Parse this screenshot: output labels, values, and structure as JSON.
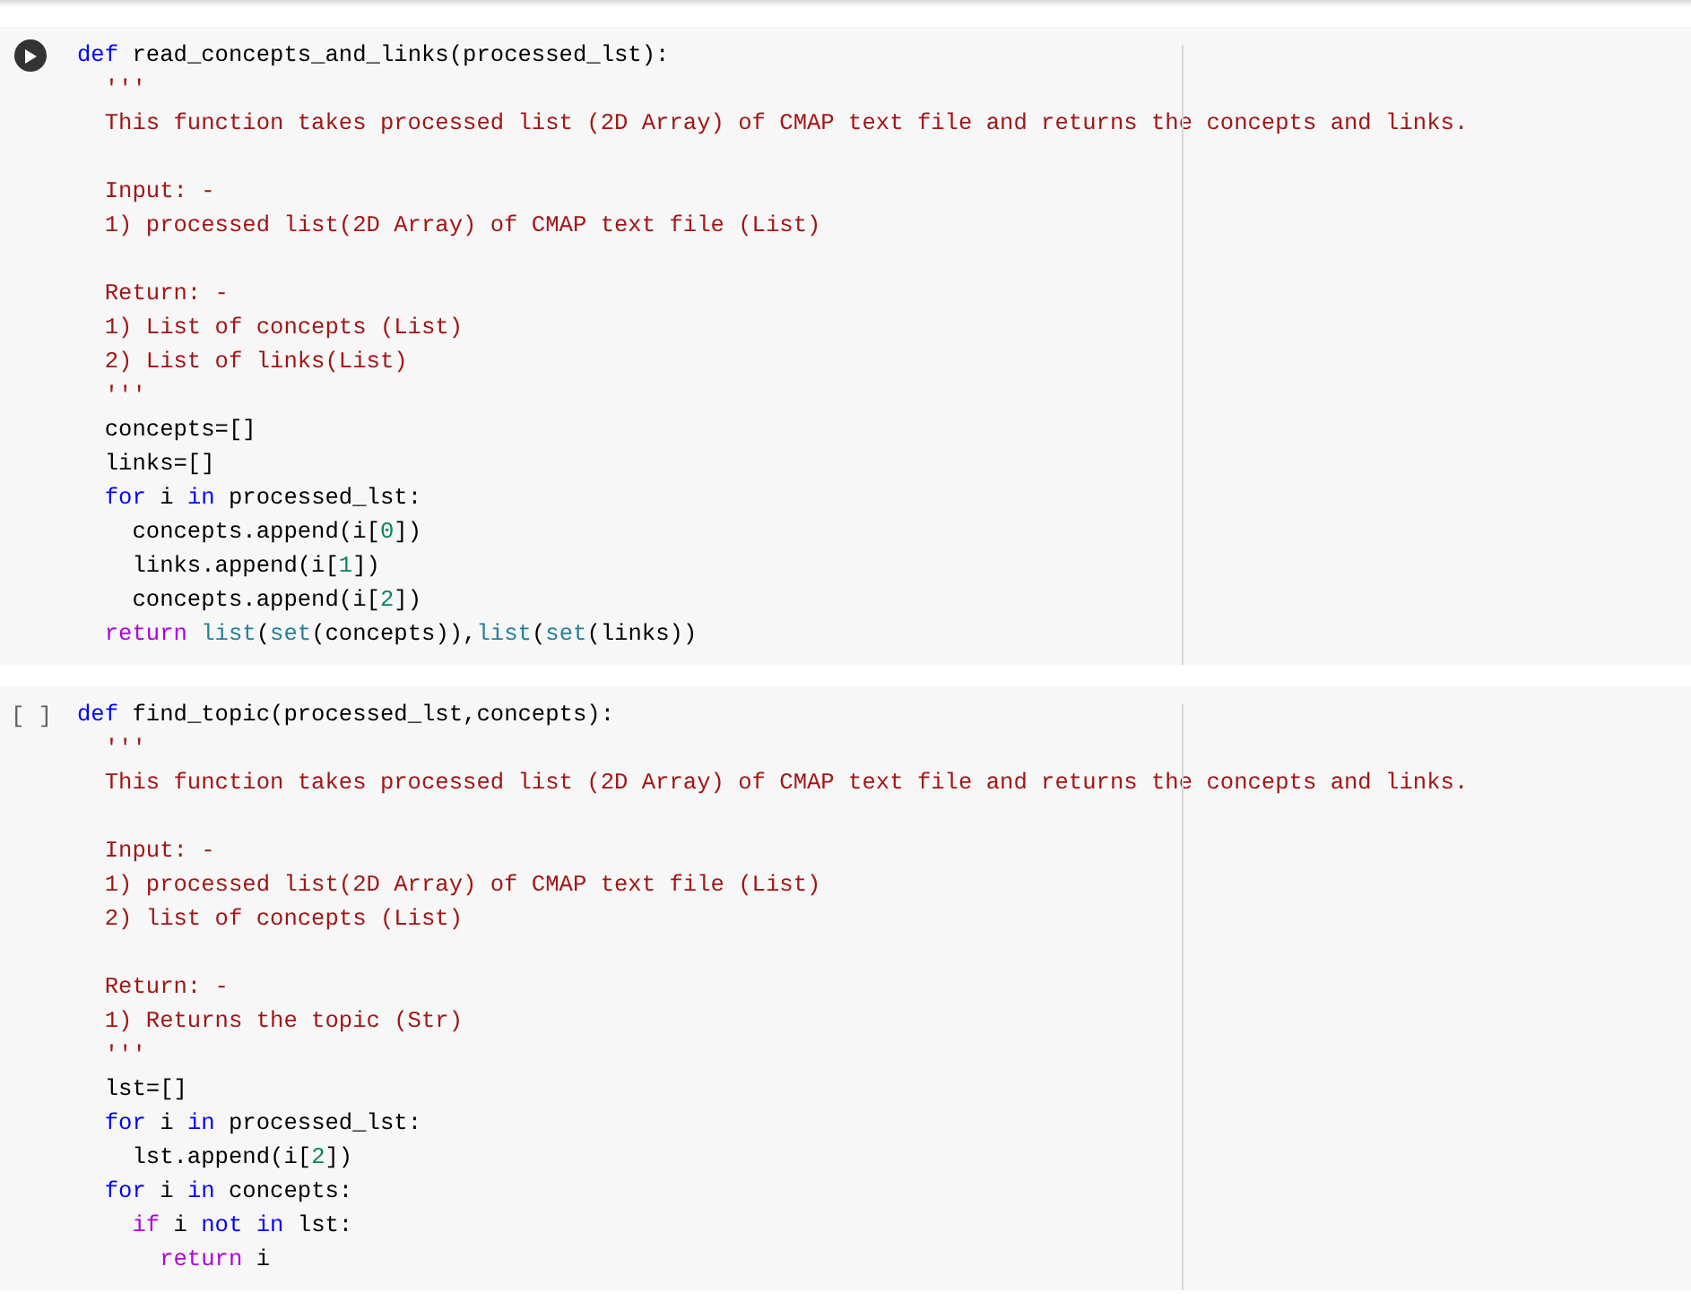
{
  "cells": [
    {
      "gutter": {
        "kind": "run_button"
      },
      "lines": [
        {
          "kind": "code",
          "tokens": [
            {
              "kind": "kw",
              "text": "def"
            },
            {
              "kind": "p",
              "text": " read_concepts_and_links(processed_lst):"
            }
          ]
        },
        {
          "kind": "code",
          "tokens": [
            {
              "kind": "str",
              "text": "  '''"
            }
          ]
        },
        {
          "kind": "code",
          "tokens": [
            {
              "kind": "str",
              "text": "  This function takes processed list (2D Array) of CMAP text file and returns the concepts and links."
            }
          ]
        },
        {
          "kind": "blank"
        },
        {
          "kind": "code",
          "tokens": [
            {
              "kind": "str",
              "text": "  Input: -"
            }
          ]
        },
        {
          "kind": "code",
          "tokens": [
            {
              "kind": "str",
              "text": "  1) processed list(2D Array) of CMAP text file (List)"
            }
          ]
        },
        {
          "kind": "blank"
        },
        {
          "kind": "code",
          "tokens": [
            {
              "kind": "str",
              "text": "  Return: -"
            }
          ]
        },
        {
          "kind": "code",
          "tokens": [
            {
              "kind": "str",
              "text": "  1) List of concepts (List)"
            }
          ]
        },
        {
          "kind": "code",
          "tokens": [
            {
              "kind": "str",
              "text": "  2) List of links(List)"
            }
          ]
        },
        {
          "kind": "code",
          "tokens": [
            {
              "kind": "str",
              "text": "  '''"
            }
          ]
        },
        {
          "kind": "code",
          "tokens": [
            {
              "kind": "p",
              "text": "  concepts=[]"
            }
          ]
        },
        {
          "kind": "code",
          "tokens": [
            {
              "kind": "p",
              "text": "  links=[]"
            }
          ]
        },
        {
          "kind": "code",
          "tokens": [
            {
              "kind": "kw",
              "text": "  for"
            },
            {
              "kind": "p",
              "text": " i "
            },
            {
              "kind": "kw",
              "text": "in"
            },
            {
              "kind": "p",
              "text": " processed_lst:"
            }
          ]
        },
        {
          "kind": "code",
          "tokens": [
            {
              "kind": "p",
              "text": "    concepts.append(i["
            },
            {
              "kind": "num",
              "text": "0"
            },
            {
              "kind": "p",
              "text": "])"
            }
          ]
        },
        {
          "kind": "code",
          "tokens": [
            {
              "kind": "p",
              "text": "    links.append(i["
            },
            {
              "kind": "num",
              "text": "1"
            },
            {
              "kind": "p",
              "text": "])"
            }
          ]
        },
        {
          "kind": "code",
          "tokens": [
            {
              "kind": "p",
              "text": "    concepts.append(i["
            },
            {
              "kind": "num",
              "text": "2"
            },
            {
              "kind": "p",
              "text": "])"
            }
          ]
        },
        {
          "kind": "code",
          "tokens": [
            {
              "kind": "ctrl",
              "text": "  return"
            },
            {
              "kind": "bi",
              "text": " list"
            },
            {
              "kind": "p",
              "text": "("
            },
            {
              "kind": "bi",
              "text": "set"
            },
            {
              "kind": "p",
              "text": "(concepts)),"
            },
            {
              "kind": "bi",
              "text": "list"
            },
            {
              "kind": "p",
              "text": "("
            },
            {
              "kind": "bi",
              "text": "set"
            },
            {
              "kind": "p",
              "text": "(links))"
            }
          ]
        }
      ]
    },
    {
      "gutter": {
        "kind": "execution_count",
        "text": "[ ]"
      },
      "lines": [
        {
          "kind": "code",
          "tokens": [
            {
              "kind": "kw",
              "text": "def"
            },
            {
              "kind": "p",
              "text": " find_topic(processed_lst,concepts):"
            }
          ]
        },
        {
          "kind": "code",
          "tokens": [
            {
              "kind": "str",
              "text": "  '''"
            }
          ]
        },
        {
          "kind": "code",
          "tokens": [
            {
              "kind": "str",
              "text": "  This function takes processed list (2D Array) of CMAP text file and returns the concepts and links."
            }
          ]
        },
        {
          "kind": "blank"
        },
        {
          "kind": "code",
          "tokens": [
            {
              "kind": "str",
              "text": "  Input: -"
            }
          ]
        },
        {
          "kind": "code",
          "tokens": [
            {
              "kind": "str",
              "text": "  1) processed list(2D Array) of CMAP text file (List)"
            }
          ]
        },
        {
          "kind": "code",
          "tokens": [
            {
              "kind": "str",
              "text": "  2) list of concepts (List)"
            }
          ]
        },
        {
          "kind": "blank"
        },
        {
          "kind": "code",
          "tokens": [
            {
              "kind": "str",
              "text": "  Return: -"
            }
          ]
        },
        {
          "kind": "code",
          "tokens": [
            {
              "kind": "str",
              "text": "  1) Returns the topic (Str)"
            }
          ]
        },
        {
          "kind": "code",
          "tokens": [
            {
              "kind": "str",
              "text": "  '''"
            }
          ]
        },
        {
          "kind": "code",
          "tokens": [
            {
              "kind": "p",
              "text": "  lst=[]"
            }
          ]
        },
        {
          "kind": "code",
          "tokens": [
            {
              "kind": "kw",
              "text": "  for"
            },
            {
              "kind": "p",
              "text": " i "
            },
            {
              "kind": "kw",
              "text": "in"
            },
            {
              "kind": "p",
              "text": " processed_lst:"
            }
          ]
        },
        {
          "kind": "code",
          "tokens": [
            {
              "kind": "p",
              "text": "    lst.append(i["
            },
            {
              "kind": "num",
              "text": "2"
            },
            {
              "kind": "p",
              "text": "])"
            }
          ]
        },
        {
          "kind": "code",
          "tokens": [
            {
              "kind": "kw",
              "text": "  for"
            },
            {
              "kind": "p",
              "text": " i "
            },
            {
              "kind": "kw",
              "text": "in"
            },
            {
              "kind": "p",
              "text": " concepts:"
            }
          ]
        },
        {
          "kind": "code",
          "tokens": [
            {
              "kind": "ctrl",
              "text": "    if"
            },
            {
              "kind": "p",
              "text": " i "
            },
            {
              "kind": "kw",
              "text": "not"
            },
            {
              "kind": "kw",
              "text": " in"
            },
            {
              "kind": "p",
              "text": " lst:"
            }
          ]
        },
        {
          "kind": "code",
          "tokens": [
            {
              "kind": "ctrl",
              "text": "      return"
            },
            {
              "kind": "p",
              "text": " i"
            }
          ]
        }
      ]
    }
  ]
}
